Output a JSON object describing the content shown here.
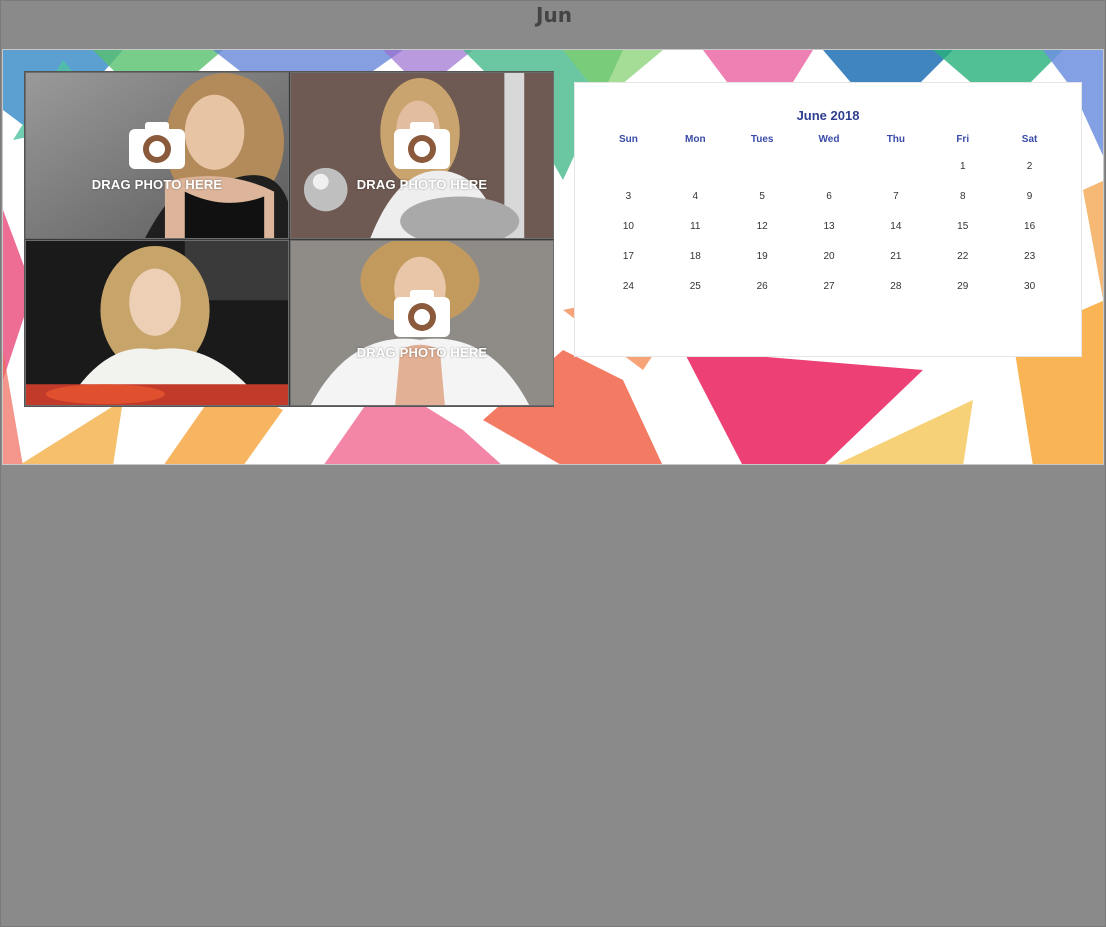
{
  "header": {
    "month_label": "Jun"
  },
  "photos": [
    {
      "drag_label": "DRAG PHOTO HERE",
      "show_overlay": true
    },
    {
      "drag_label": "DRAG PHOTO HERE",
      "show_overlay": true
    },
    {
      "drag_label": "",
      "show_overlay": false
    },
    {
      "drag_label": "DRAG PHOTO HERE",
      "show_overlay": true
    }
  ],
  "calendar": {
    "title": "June 2018",
    "weekdays": [
      "Sun",
      "Mon",
      "Tues",
      "Wed",
      "Thu",
      "Fri",
      "Sat"
    ],
    "weeks": [
      [
        "",
        "",
        "",
        "",
        "",
        "1",
        "2"
      ],
      [
        "3",
        "4",
        "5",
        "6",
        "7",
        "8",
        "9"
      ],
      [
        "10",
        "11",
        "12",
        "13",
        "14",
        "15",
        "16"
      ],
      [
        "17",
        "18",
        "19",
        "20",
        "21",
        "22",
        "23"
      ],
      [
        "24",
        "25",
        "26",
        "27",
        "28",
        "29",
        "30"
      ]
    ]
  },
  "colors": {
    "title_blue": "#2f3f8f",
    "weekday_blue": "#3a4aa8",
    "background_gray": "#8a8a8a"
  }
}
